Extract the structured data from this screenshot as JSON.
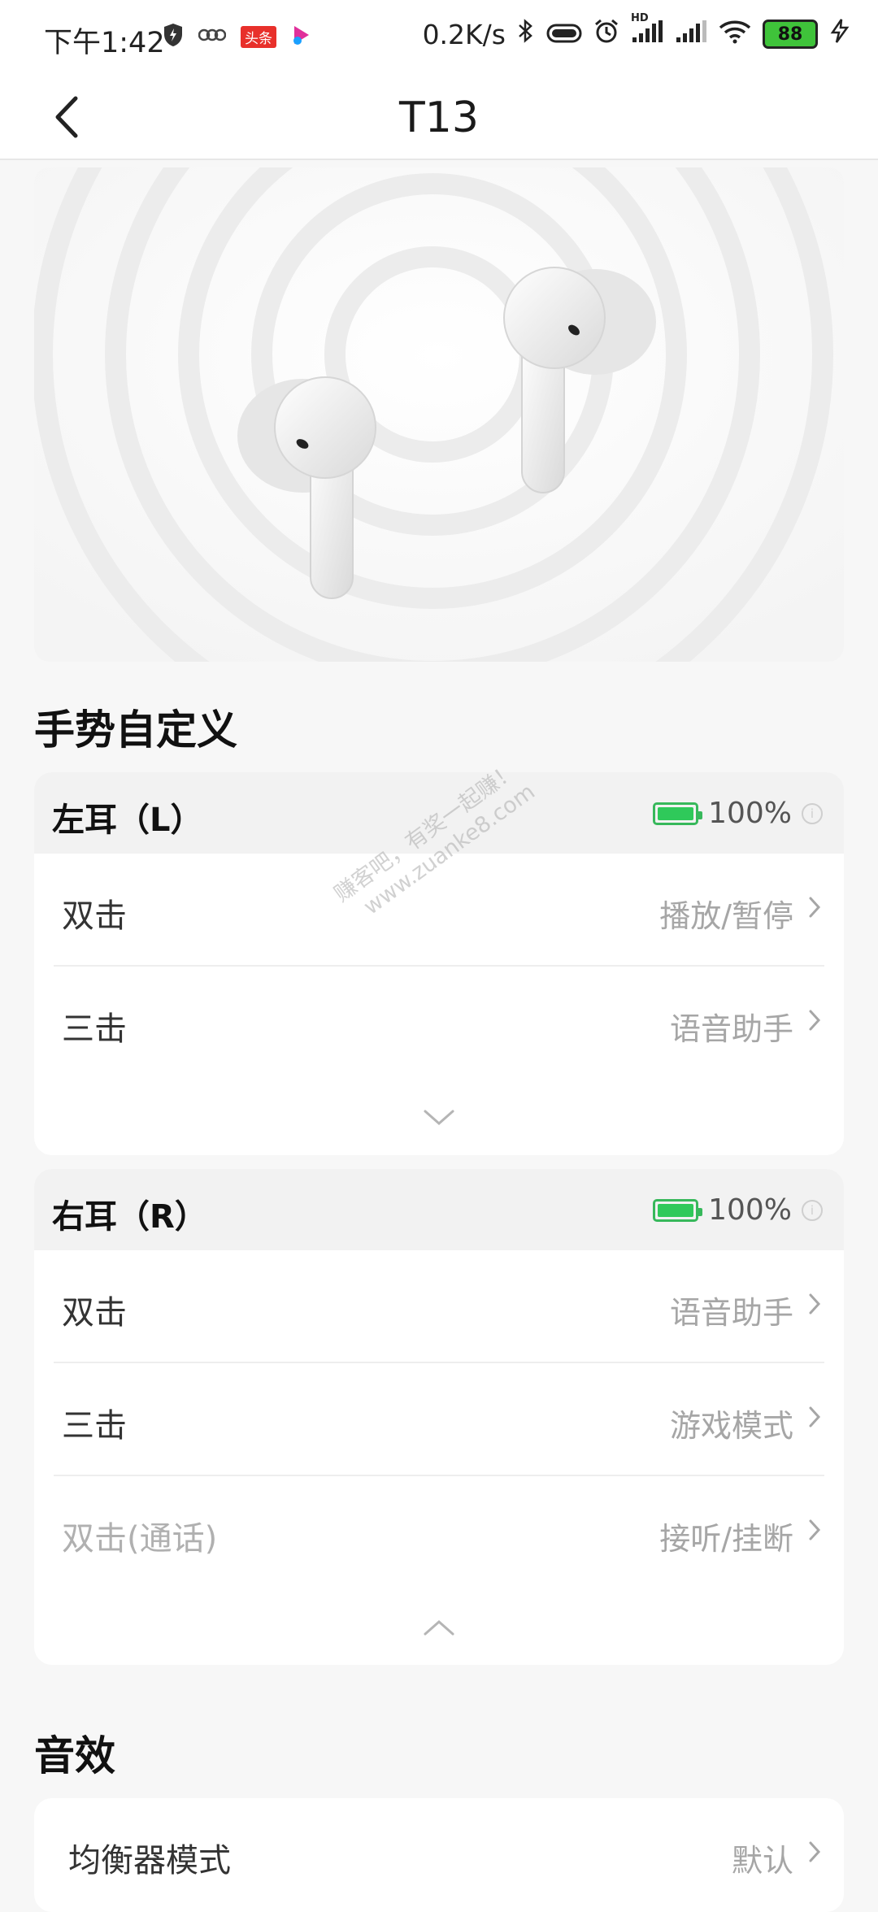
{
  "status_bar": {
    "time": "下午1:42",
    "toutiao_badge": "头条",
    "network_speed": "0.2K/s",
    "hd_label": "HD",
    "battery_level": "88"
  },
  "navbar": {
    "title": "T13"
  },
  "gesture_section": {
    "title": "手势自定义"
  },
  "left_ear": {
    "title": "左耳（L）",
    "battery": "100%",
    "rows": [
      {
        "label": "双击",
        "value": "播放/暂停"
      },
      {
        "label": "三击",
        "value": "语音助手"
      }
    ]
  },
  "right_ear": {
    "title": "右耳（R）",
    "battery": "100%",
    "rows": [
      {
        "label": "双击",
        "value": "语音助手"
      },
      {
        "label": "三击",
        "value": "游戏模式"
      },
      {
        "label": "双击(通话)",
        "value": "接听/挂断"
      }
    ]
  },
  "sound_section": {
    "title": "音效",
    "rows": [
      {
        "label": "均衡器模式",
        "value": "默认"
      }
    ]
  },
  "watermark": {
    "line1": "赚客吧，有奖一起赚！",
    "line2": "www.zuanke8.com"
  },
  "colors": {
    "battery_green": "#2fc95a",
    "card_header_bg": "#f2f2f2",
    "page_bg": "#f7f7f7"
  }
}
